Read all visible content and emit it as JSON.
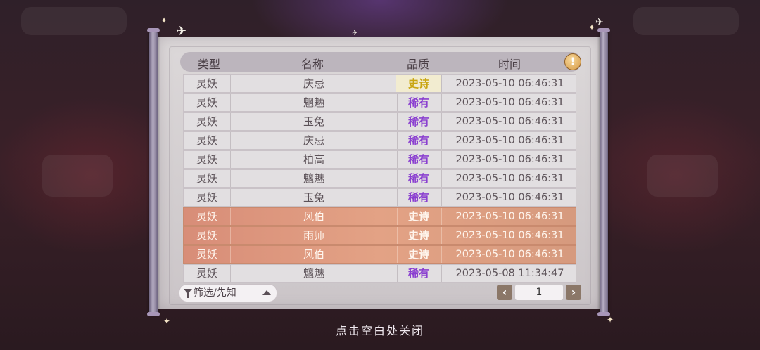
{
  "header": {
    "type": "类型",
    "name": "名称",
    "quality": "品质",
    "time": "时间"
  },
  "info_icon": "!",
  "rows": [
    {
      "type": "灵妖",
      "name": "庆忌",
      "quality": "史诗",
      "time": "2023-05-10  06:46:31"
    },
    {
      "type": "灵妖",
      "name": "魍魉",
      "quality": "稀有",
      "time": "2023-05-10  06:46:31"
    },
    {
      "type": "灵妖",
      "name": "玉兔",
      "quality": "稀有",
      "time": "2023-05-10  06:46:31"
    },
    {
      "type": "灵妖",
      "name": "庆忌",
      "quality": "稀有",
      "time": "2023-05-10  06:46:31"
    },
    {
      "type": "灵妖",
      "name": "柏高",
      "quality": "稀有",
      "time": "2023-05-10  06:46:31"
    },
    {
      "type": "灵妖",
      "name": "魑魅",
      "quality": "稀有",
      "time": "2023-05-10  06:46:31"
    },
    {
      "type": "灵妖",
      "name": "玉兔",
      "quality": "稀有",
      "time": "2023-05-10  06:46:31"
    },
    {
      "type": "灵妖",
      "name": "风伯",
      "quality": "史诗",
      "time": "2023-05-10  06:46:31"
    },
    {
      "type": "灵妖",
      "name": "雨师",
      "quality": "史诗",
      "time": "2023-05-10  06:46:31"
    },
    {
      "type": "灵妖",
      "name": "风伯",
      "quality": "史诗",
      "time": "2023-05-10  06:46:31"
    },
    {
      "type": "灵妖",
      "name": "魑魅",
      "quality": "稀有",
      "time": "2023-05-08  11:34:47"
    }
  ],
  "filter": {
    "label": "筛选/先知"
  },
  "pagination": {
    "prev": "‹",
    "page": "1",
    "next": "›"
  },
  "close_hint": "点击空白处关闭",
  "colors": {
    "epic": "#c9a510",
    "rare": "#8a3fd0",
    "highlight_row": "#e3a285"
  }
}
